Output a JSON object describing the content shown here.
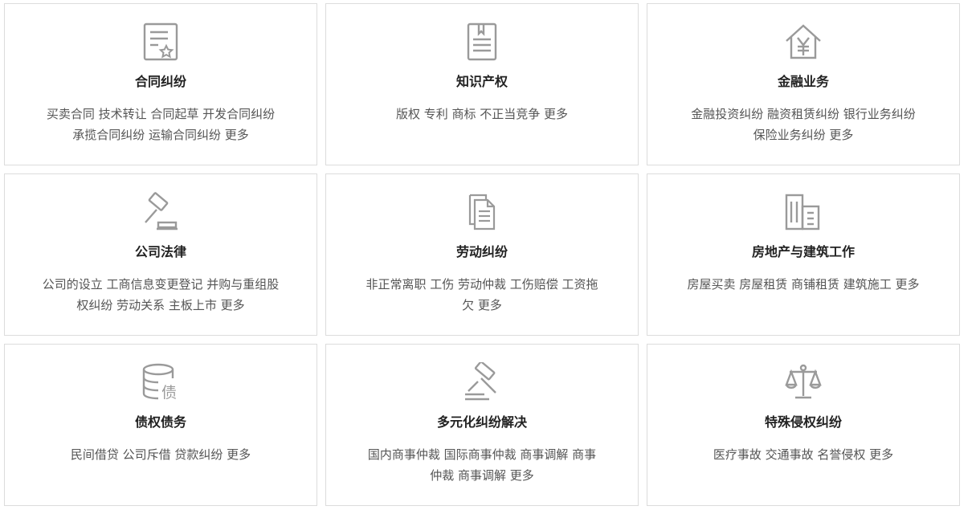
{
  "cards": [
    {
      "icon": "contract-icon",
      "title": "合同纠纷",
      "line1": "买卖合同 技术转让 合同起草 开发合同纠纷",
      "line2": "承揽合同纠纷 运输合同纠纷 更多"
    },
    {
      "icon": "book-icon",
      "title": "知识产权",
      "line1": "版权 专利 商标 不正当竞争 更多",
      "line2": ""
    },
    {
      "icon": "yen-house-icon",
      "title": "金融业务",
      "line1": "金融投资纠纷 融资租赁纠纷  银行业务纠纷",
      "line2": "保险业务纠纷 更多"
    },
    {
      "icon": "gavel-icon",
      "title": "公司法律",
      "line1": "公司的设立 工商信息变更登记 并购与重组股",
      "line2": "权纠纷 劳动关系 主板上市 更多"
    },
    {
      "icon": "documents-icon",
      "title": "劳动纠纷",
      "line1": "非正常离职 工伤 劳动仲裁 工伤赔偿 工资拖",
      "line2": "欠 更多"
    },
    {
      "icon": "building-icon",
      "title": "房地产与建筑工作",
      "line1": "房屋买卖 房屋租赁  商铺租赁 建筑施工 更多",
      "line2": ""
    },
    {
      "icon": "debt-coins-icon",
      "icon_text": "债",
      "title": "债权债务",
      "line1": "民间借贷 公司斥借 贷款纠纷  更多",
      "line2": ""
    },
    {
      "icon": "hammer-icon",
      "title": "多元化纠纷解决",
      "line1": "国内商事仲裁 国际商事仲裁 商事调解 商事",
      "line2": "仲裁 商事调解 更多"
    },
    {
      "icon": "scales-icon",
      "title": "特殊侵权纠纷",
      "line1": "医疗事故 交通事故  名誉侵权 更多",
      "line2": ""
    }
  ],
  "colors": {
    "icon_stroke": "#9a9a9a",
    "border": "#dcdcdc",
    "title": "#222222",
    "desc": "#555555"
  }
}
